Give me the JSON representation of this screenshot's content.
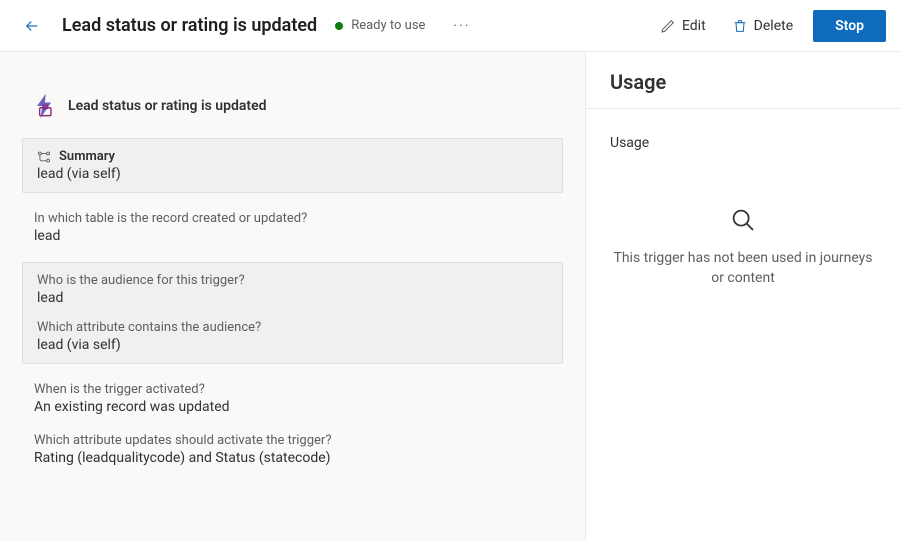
{
  "header": {
    "title": "Lead status or rating is updated",
    "status_label": "Ready to use",
    "status_color": "#107c10",
    "actions": {
      "edit": "Edit",
      "delete": "Delete",
      "stop": "Stop"
    }
  },
  "trigger": {
    "name": "Lead status or rating is updated",
    "summary_label": "Summary",
    "summary_value": "lead (via self)",
    "qa_table_q": "In which table is the record created or updated?",
    "qa_table_a": "lead",
    "audience_q": "Who is the audience for this trigger?",
    "audience_a": "lead",
    "attr_q": "Which attribute contains the audience?",
    "attr_a": "lead (via self)",
    "activated_q": "When is the trigger activated?",
    "activated_a": "An existing record was updated",
    "updates_q": "Which attribute updates should activate the trigger?",
    "updates_a": "Rating (leadqualitycode) and Status (statecode)"
  },
  "usage": {
    "title": "Usage",
    "section_label": "Usage",
    "empty_text": "This trigger has not been used in journeys or content"
  }
}
